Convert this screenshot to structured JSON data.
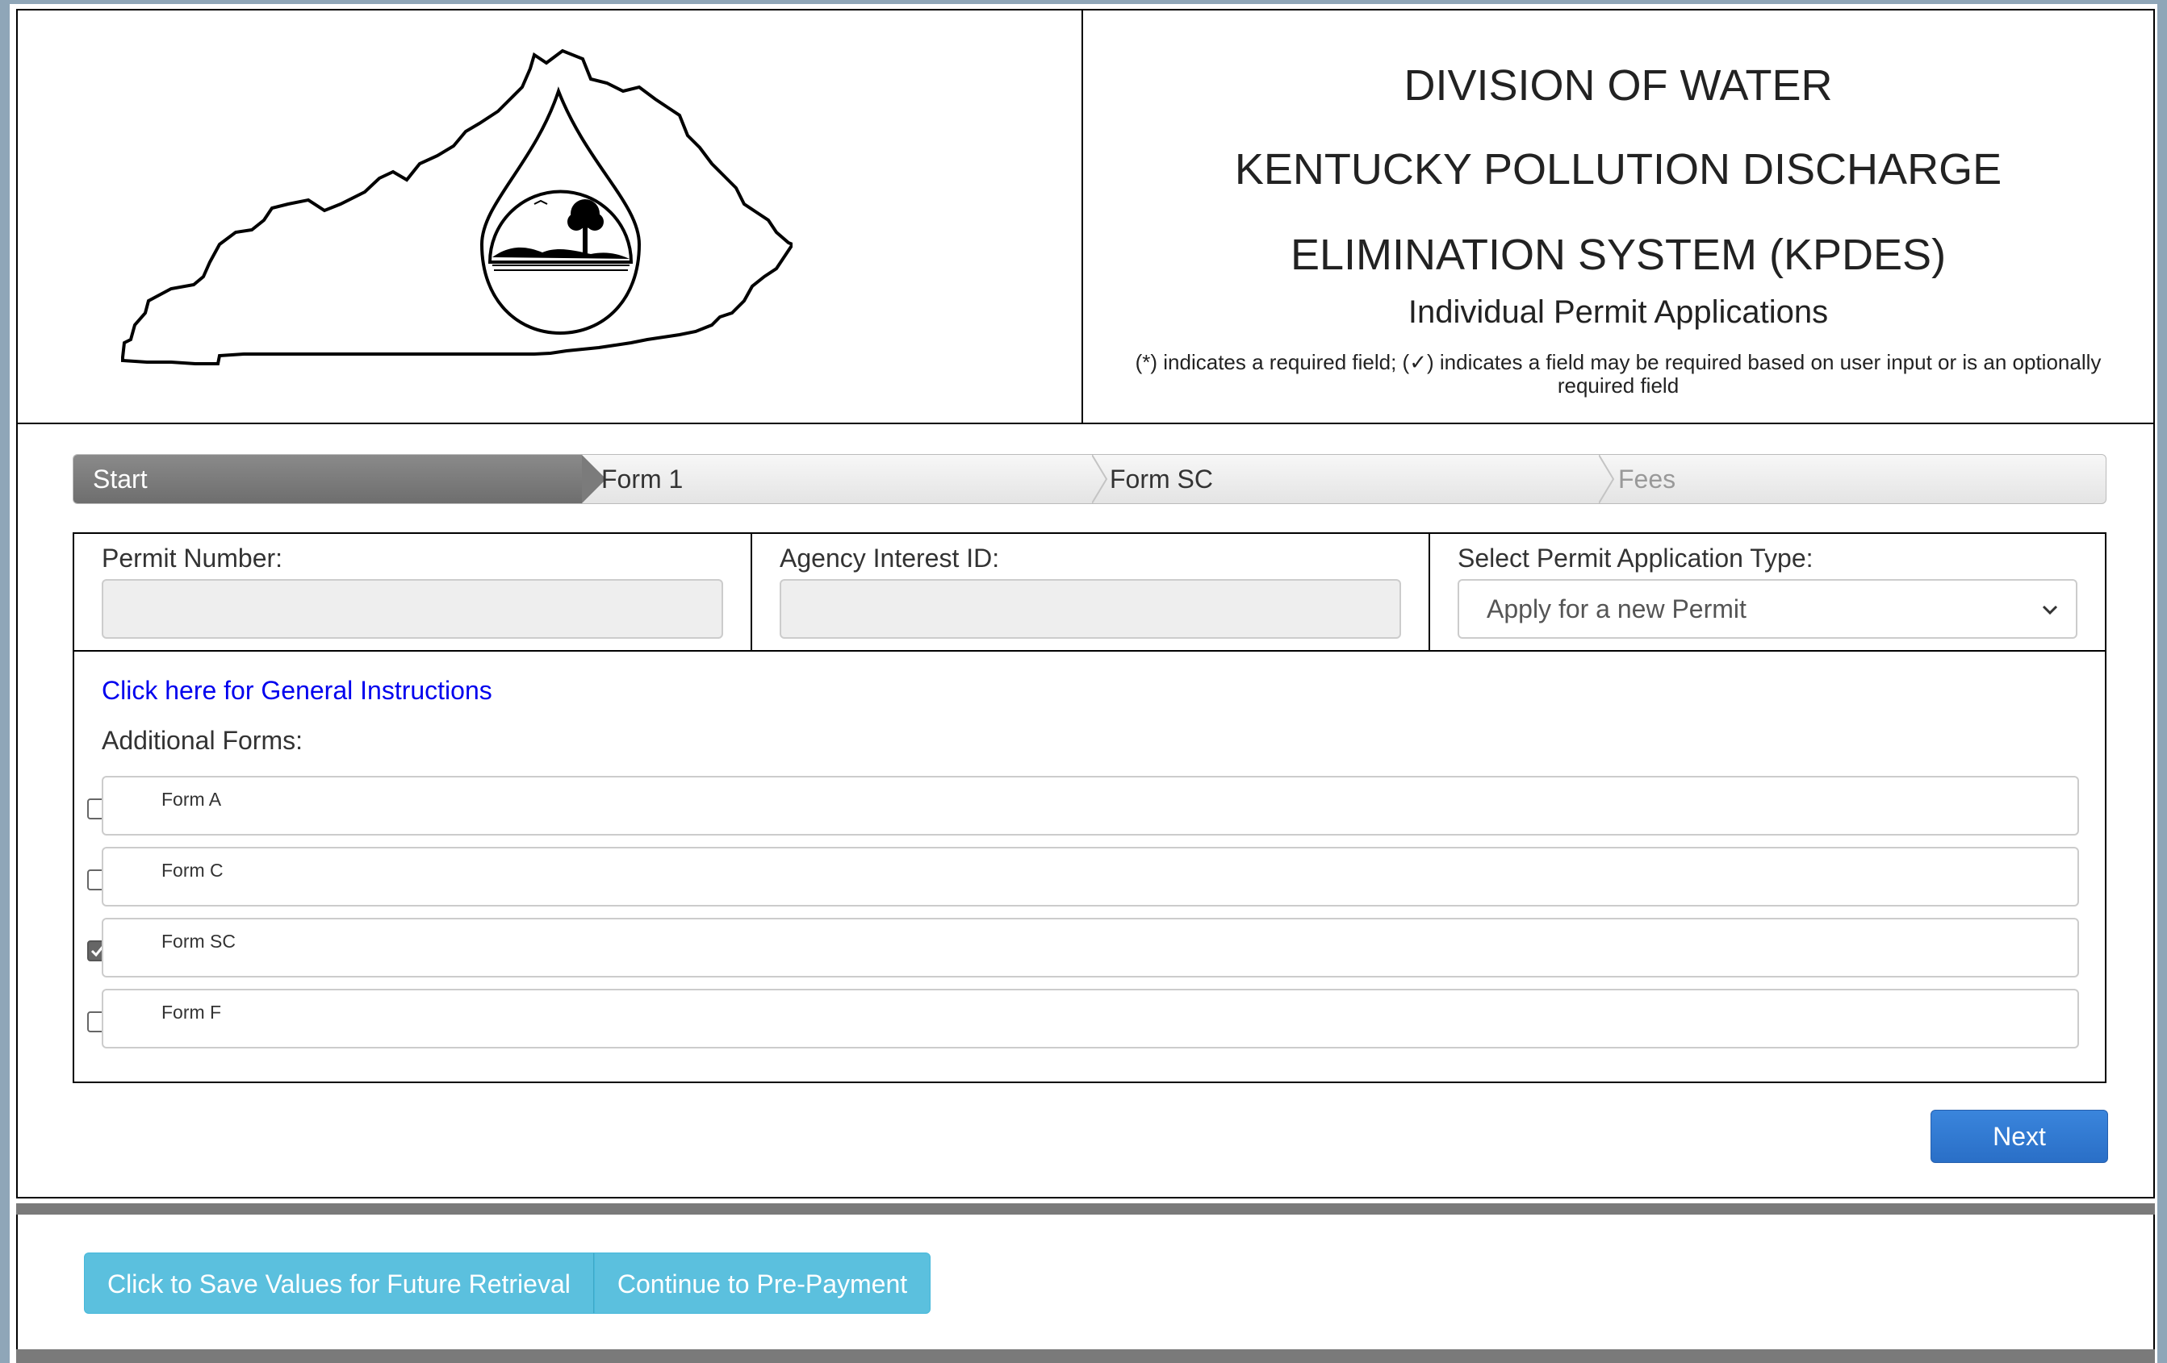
{
  "header": {
    "line1": "DIVISION OF WATER",
    "line2": "KENTUCKY POLLUTION DISCHARGE",
    "line3": "ELIMINATION SYSTEM (KPDES)",
    "subtitle": "Individual Permit Applications",
    "note": "(*) indicates a required field; (✓) indicates a field may be required based on user input or is an optionally required field"
  },
  "wizard": {
    "steps": [
      {
        "label": "Start",
        "state": "active"
      },
      {
        "label": "Form 1",
        "state": "normal"
      },
      {
        "label": "Form SC",
        "state": "normal"
      },
      {
        "label": "Fees",
        "state": "disabled"
      }
    ]
  },
  "fields": {
    "permit_number": {
      "label": "Permit Number:",
      "value": ""
    },
    "agency_interest": {
      "label": "Agency Interest ID:",
      "value": ""
    },
    "application_type": {
      "label": "Select Permit Application Type:",
      "selected": "Apply for a new Permit"
    }
  },
  "instructions_link": "Click here for General Instructions",
  "additional_forms": {
    "label": "Additional Forms:",
    "items": [
      {
        "label": "Form A",
        "checked": false
      },
      {
        "label": "Form C",
        "checked": false
      },
      {
        "label": "Form SC",
        "checked": true
      },
      {
        "label": "Form F",
        "checked": false
      }
    ]
  },
  "buttons": {
    "next": "Next",
    "save": "Click to Save Values for Future Retrieval",
    "prepay": "Continue to Pre-Payment"
  },
  "colors": {
    "link": "#0000ee",
    "primary": "#2a6fc7",
    "info": "#5bc0de",
    "active_step": "#7b7b7b"
  }
}
